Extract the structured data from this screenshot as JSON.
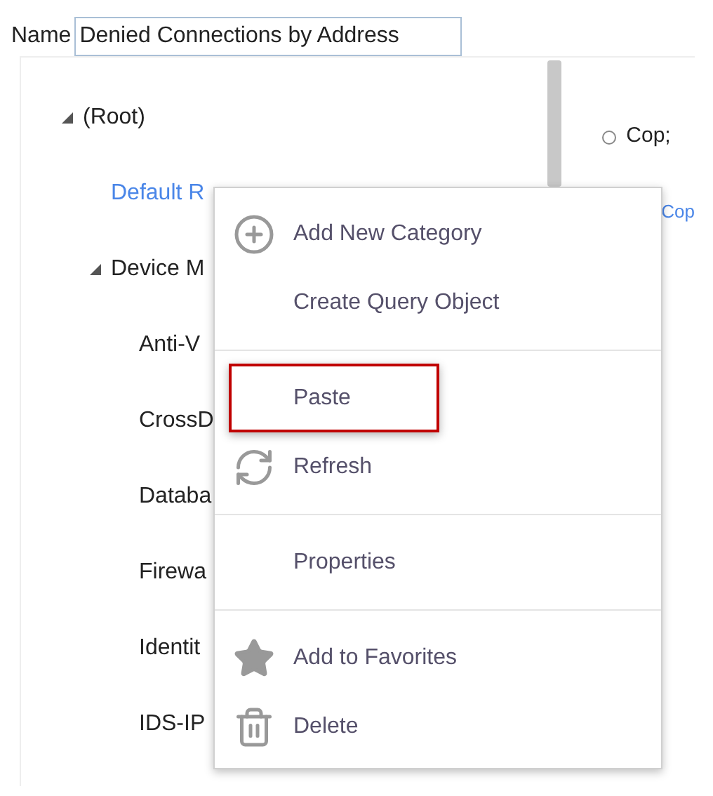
{
  "name_field": {
    "label": "Name",
    "value": "Denied Connections by Address"
  },
  "tree": [
    {
      "label": "(Root)",
      "kind": "folder",
      "expanded": true,
      "children": [
        {
          "label": "Default R",
          "kind": "link"
        },
        {
          "label": "Device M",
          "kind": "folder",
          "expanded": true,
          "children": [
            {
              "label": "Anti-V",
              "kind": "item"
            },
            {
              "label": "CrossD",
              "kind": "item"
            },
            {
              "label": "Databa",
              "kind": "item"
            },
            {
              "label": "Firewa",
              "kind": "item"
            },
            {
              "label": "Identit",
              "kind": "item"
            },
            {
              "label": "IDS-IP",
              "kind": "item"
            }
          ]
        }
      ]
    }
  ],
  "options": [
    {
      "label": "Cop;",
      "kind": "text",
      "selected": false
    },
    {
      "label": "Cop",
      "kind": "link"
    }
  ],
  "context_menu": {
    "groups": [
      [
        {
          "label": "Add New Category",
          "highlighted": false
        },
        {
          "label": "Create Query Object",
          "highlighted": false
        }
      ],
      [
        {
          "label": "Paste",
          "highlighted": true
        },
        {
          "label": "Refresh",
          "highlighted": false
        }
      ],
      [
        {
          "label": "Properties",
          "highlighted": false
        }
      ],
      [
        {
          "label": "Add to Favorites",
          "highlighted": false
        },
        {
          "label": "Delete",
          "highlighted": false
        }
      ]
    ]
  }
}
